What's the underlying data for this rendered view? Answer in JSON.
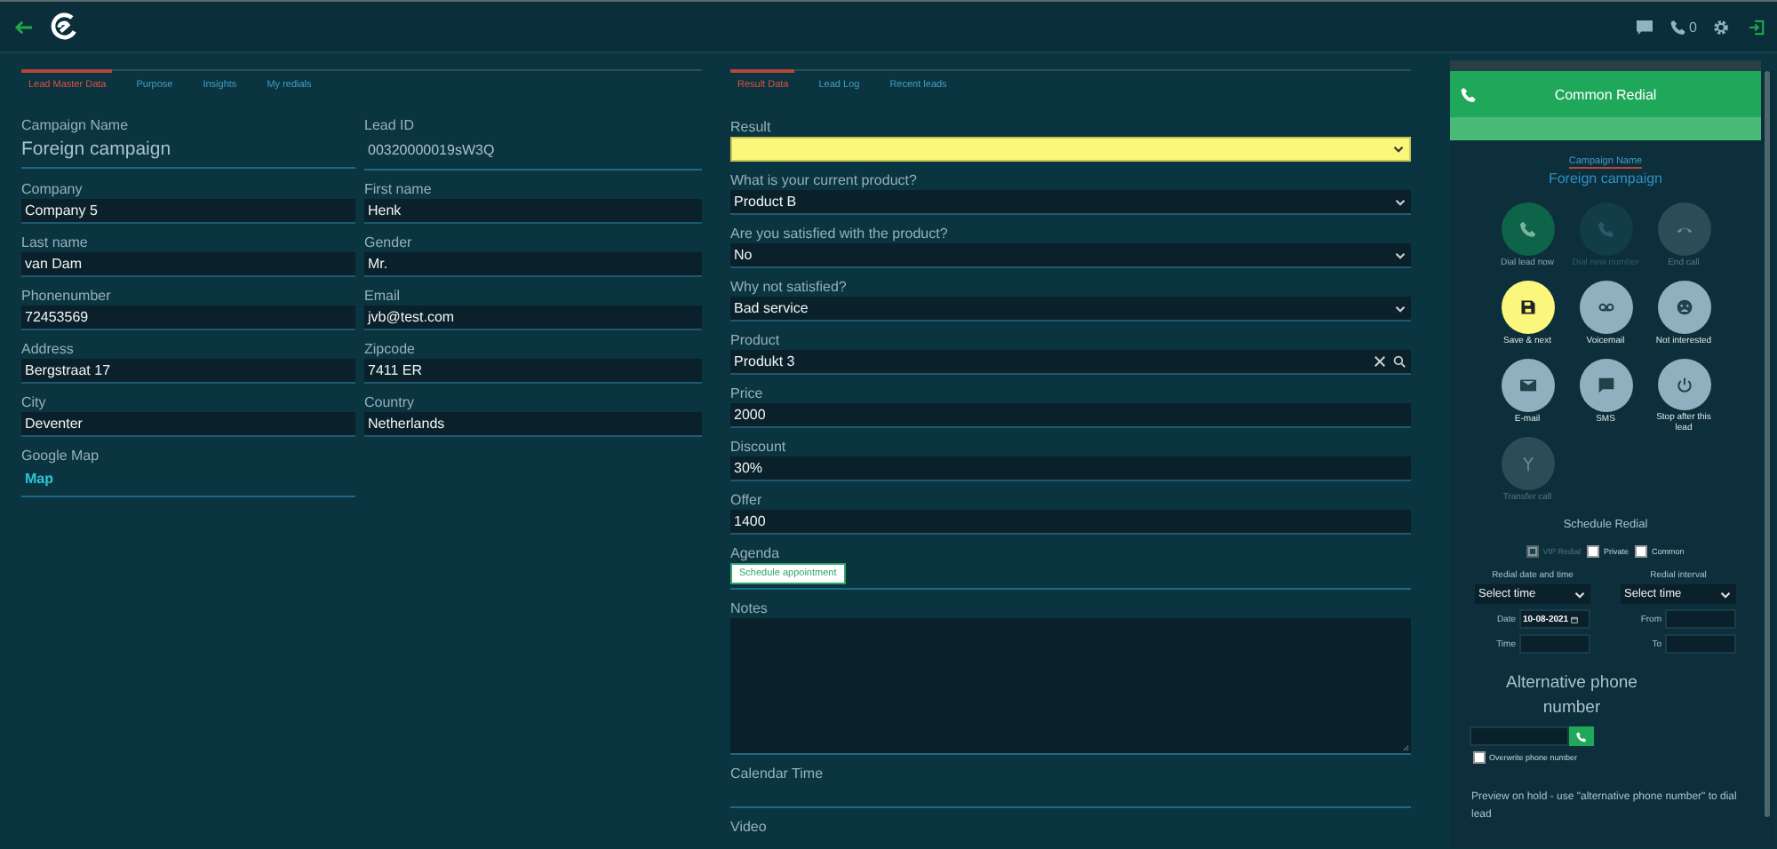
{
  "topbar": {
    "call_count": "0"
  },
  "lead": {
    "tabs": [
      {
        "label": "Lead Master Data",
        "selected": true
      },
      {
        "label": "Purpose",
        "selected": false
      },
      {
        "label": "Insights",
        "selected": false
      },
      {
        "label": "My redials",
        "selected": false
      }
    ],
    "campaign": {
      "label": "Campaign Name",
      "value": "Foreign campaign"
    },
    "lead_id": {
      "label": "Lead ID",
      "value": "00320000019sW3Q"
    },
    "fields": [
      {
        "label": "Company",
        "value": "Company 5"
      },
      {
        "label": "First name",
        "value": "Henk"
      },
      {
        "label": "Last name",
        "value": "van Dam"
      },
      {
        "label": "Gender",
        "value": "Mr."
      },
      {
        "label": "Phonenumber",
        "value": "72453569"
      },
      {
        "label": "Email",
        "value": "jvb@test.com"
      },
      {
        "label": "Address",
        "value": "Bergstraat 17"
      },
      {
        "label": "Zipcode",
        "value": "7411 ER"
      },
      {
        "label": "City",
        "value": "Deventer"
      },
      {
        "label": "Country",
        "value": "Netherlands"
      }
    ],
    "google_map": {
      "label": "Google Map",
      "link": "Map"
    }
  },
  "result": {
    "tabs": [
      {
        "label": "Result Data",
        "selected": true
      },
      {
        "label": "Lead Log",
        "selected": false
      },
      {
        "label": "Recent leads",
        "selected": false
      }
    ],
    "fields": [
      {
        "kind": "select",
        "label": "Result",
        "highlighted": true
      },
      {
        "kind": "select",
        "label": "What is your current product?",
        "value": "Product B",
        "highlighted": false
      },
      {
        "kind": "select",
        "label": "Are you satisfied with the product?",
        "value": "No",
        "highlighted": false
      },
      {
        "kind": "select",
        "label": "Why not satisfied?",
        "value": "Bad service",
        "highlighted": false
      },
      {
        "kind": "search",
        "label": "Product",
        "value": "Produkt 3",
        "highlighted": false
      },
      {
        "kind": "text",
        "label": "Price",
        "value": "2000",
        "highlighted": false
      },
      {
        "kind": "text",
        "label": "Discount",
        "value": "30%",
        "highlighted": false
      },
      {
        "kind": "text",
        "label": "Offer",
        "value": "1400",
        "highlighted": false
      }
    ],
    "agenda": {
      "label": "Agenda",
      "button": "Schedule appointment"
    },
    "notes": {
      "label": "Notes"
    },
    "calendar_time": {
      "label": "Calendar Time"
    },
    "video": {
      "label": "Video"
    }
  },
  "redial": {
    "title": "Common Redial",
    "campaign_label": "Campaign Name",
    "campaign": "Foreign campaign",
    "actions": [
      {
        "label": "Dial lead now",
        "kind": "green"
      },
      {
        "label": "Dial new number",
        "kind": "disabled"
      },
      {
        "label": "End call",
        "kind": "muted"
      },
      {
        "label": "Save & next",
        "kind": "yellow"
      },
      {
        "label": "Voicemail",
        "kind": "normal"
      },
      {
        "label": "Not interested",
        "kind": "normal"
      },
      {
        "label": "E-mail",
        "kind": "normal"
      },
      {
        "label": "SMS",
        "kind": "normal"
      },
      {
        "label": "Stop after this lead",
        "kind": "normal"
      },
      {
        "label": "Transfer call",
        "kind": "muted"
      }
    ],
    "schedule_title": "Schedule Redial",
    "options": [
      {
        "label": "VIP Redial",
        "checked": true,
        "disabled": true
      },
      {
        "label": "Private",
        "checked": false,
        "disabled": false
      },
      {
        "label": "Common",
        "checked": false,
        "disabled": false
      }
    ],
    "date_time": {
      "label": "Redial date and time",
      "select": "Select time",
      "date_label": "Date",
      "date": "10-08-2021",
      "time_label": "Time"
    },
    "interval": {
      "label": "Redial interval",
      "select": "Select time",
      "from_label": "From",
      "to_label": "To"
    },
    "alt_phone": {
      "title": "Alternative phone number",
      "overwrite": {
        "label": "Overwrite phone number",
        "checked": false
      }
    },
    "preview_note": "Preview on hold - use \"alternative phone number\" to dial lead"
  }
}
